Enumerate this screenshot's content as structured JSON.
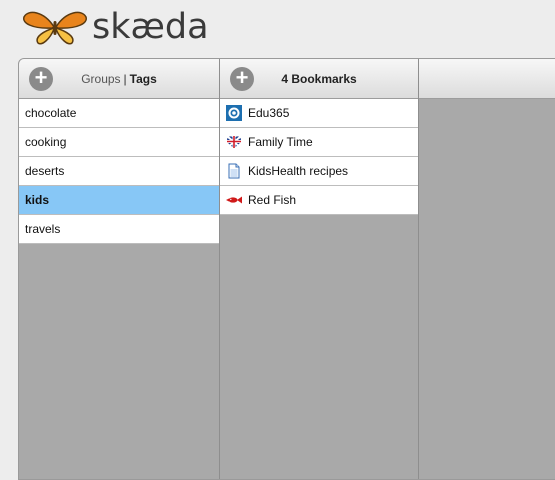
{
  "app": {
    "logo_text": "skæda"
  },
  "groups_panel": {
    "add_label": "+",
    "header_groups": "Groups",
    "header_sep": "|",
    "header_tags": "Tags",
    "items": [
      {
        "label": "chocolate",
        "selected": false
      },
      {
        "label": "cooking",
        "selected": false
      },
      {
        "label": "deserts",
        "selected": false
      },
      {
        "label": "kids",
        "selected": true
      },
      {
        "label": "travels",
        "selected": false
      }
    ]
  },
  "bookmarks_panel": {
    "add_label": "+",
    "header": "4 Bookmarks",
    "items": [
      {
        "label": "Edu365",
        "icon": "edu365-favicon-icon"
      },
      {
        "label": "Family Time",
        "icon": "uk-flag-heart-icon"
      },
      {
        "label": "KidsHealth recipes",
        "icon": "document-icon"
      },
      {
        "label": "Red Fish",
        "icon": "red-fish-icon"
      }
    ]
  },
  "colors": {
    "selected_row": "#87c7f6",
    "panel_bg": "#a9a9a9",
    "logo_orange": "#e8841c"
  }
}
